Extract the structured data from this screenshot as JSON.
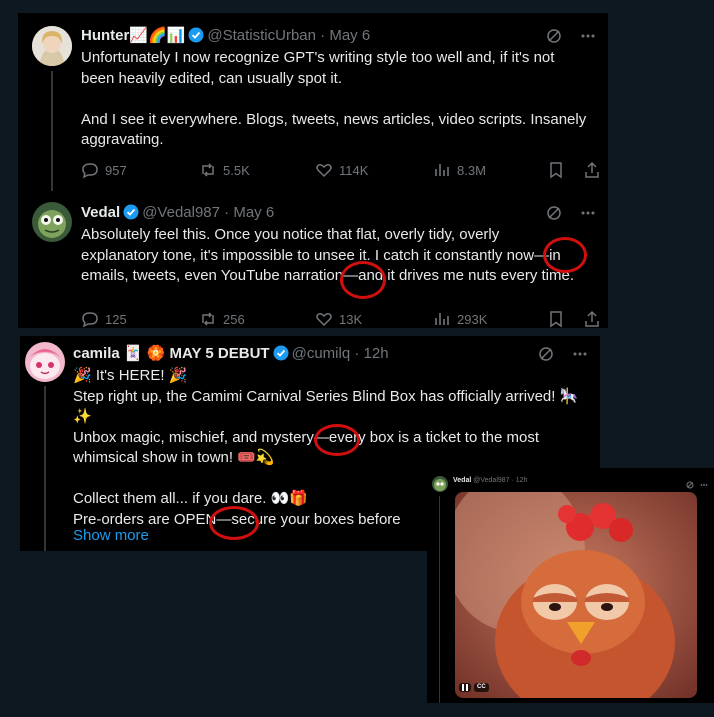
{
  "tweet1": {
    "name": "Hunter📈🌈📊",
    "handle": "@StatisticUrban",
    "date": "· May 6",
    "text": "Unfortunately I now recognize GPT's writing style too well and, if it's not\nbeen heavily edited, can usually spot it.\n\nAnd I see it everywhere. Blogs, tweets, news articles, video scripts. Insanely\naggravating.",
    "replies": "957",
    "reposts": "5.5K",
    "likes": "114K",
    "views": "8.3M"
  },
  "tweet2": {
    "name": "Vedal",
    "handle": "@Vedal987",
    "date": "· May 6",
    "text": "Absolutely feel this. Once you notice that flat, overly tidy, overly\nexplanatory tone, it's impossible to unsee it. I catch it constantly now—in\nemails, tweets, even YouTube narration—and it drives me nuts every time.",
    "replies": "125",
    "reposts": "256",
    "likes": "13K",
    "views": "293K"
  },
  "tweet3": {
    "name": "camila 🃏 🏵️ MAY 5 DEBUT",
    "handle": "@cumilq",
    "date": "· 12h",
    "text": "🎉 It's HERE! 🎉\nStep right up, the Camimi Carnival Series Blind Box has officially arrived! 🎠\n✨\nUnbox magic, mischief, and mystery—every box is a ticket to the most\nwhimsical show in town! 🎟️💫\n\nCollect them all... if you dare. 👀🎁\nPre-orders are OPEN—secure your boxes before",
    "show_more": "Show more"
  },
  "video_tweet": {
    "name": "Vedal",
    "handle": "@Vedal987 · 12h",
    "cc_label": "CC"
  },
  "colors": {
    "background": "#0d1820",
    "panel": "#000000",
    "accent": "#1d9bf0",
    "muted": "#71767b",
    "annotation": "#d20f0f"
  }
}
